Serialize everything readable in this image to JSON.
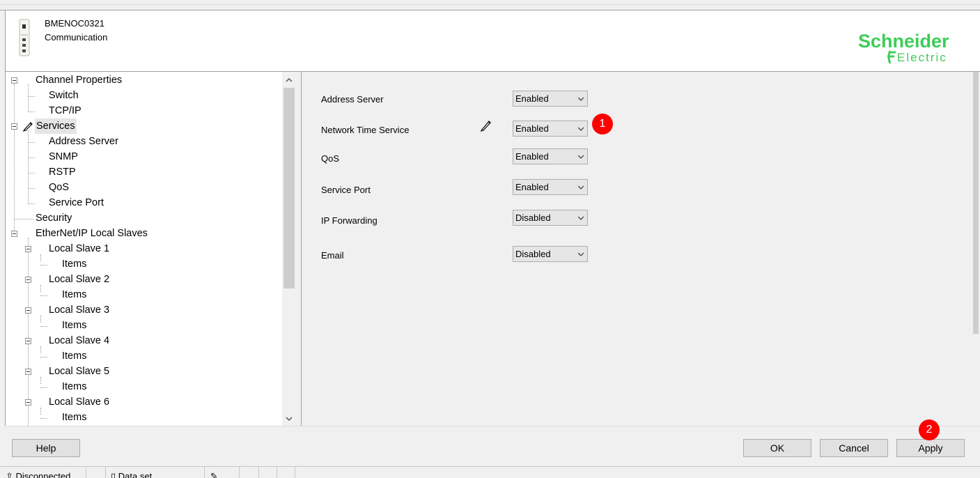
{
  "header": {
    "module_name": "BMENOC0321",
    "module_category": "Communication",
    "logo_line1": "Schneider",
    "logo_line2": "Electric",
    "brand_color": "#3dcd58"
  },
  "tree": {
    "items": [
      {
        "label": "Channel Properties"
      },
      {
        "label": "Switch"
      },
      {
        "label": "TCP/IP"
      },
      {
        "label": "Services"
      },
      {
        "label": "Address Server"
      },
      {
        "label": "SNMP"
      },
      {
        "label": "RSTP"
      },
      {
        "label": "QoS"
      },
      {
        "label": "Service Port"
      },
      {
        "label": "Security"
      },
      {
        "label": "EtherNet/IP Local Slaves"
      },
      {
        "label": "Local Slave 1"
      },
      {
        "label": "Items"
      },
      {
        "label": "Local Slave 2"
      },
      {
        "label": "Items"
      },
      {
        "label": "Local Slave 3"
      },
      {
        "label": "Items"
      },
      {
        "label": "Local Slave 4"
      },
      {
        "label": "Items"
      },
      {
        "label": "Local Slave 5"
      },
      {
        "label": "Items"
      },
      {
        "label": "Local Slave 6"
      },
      {
        "label": "Items"
      }
    ],
    "selected": "Services"
  },
  "form": {
    "fields": [
      {
        "label": "Address Server",
        "value": "Enabled"
      },
      {
        "label": "Network Time Service",
        "value": "Enabled"
      },
      {
        "label": "QoS",
        "value": "Enabled"
      },
      {
        "label": "Service Port",
        "value": "Enabled"
      },
      {
        "label": "IP Forwarding",
        "value": "Disabled"
      },
      {
        "label": "Email",
        "value": "Disabled"
      }
    ]
  },
  "annotations": {
    "badge1": "1",
    "badge2": "2",
    "badge_color": "#ff0000"
  },
  "buttons": {
    "help": "Help",
    "ok": "OK",
    "cancel": "Cancel",
    "apply": "Apply"
  },
  "status": {
    "connection": "Disconnected",
    "dataset": "Data set"
  }
}
